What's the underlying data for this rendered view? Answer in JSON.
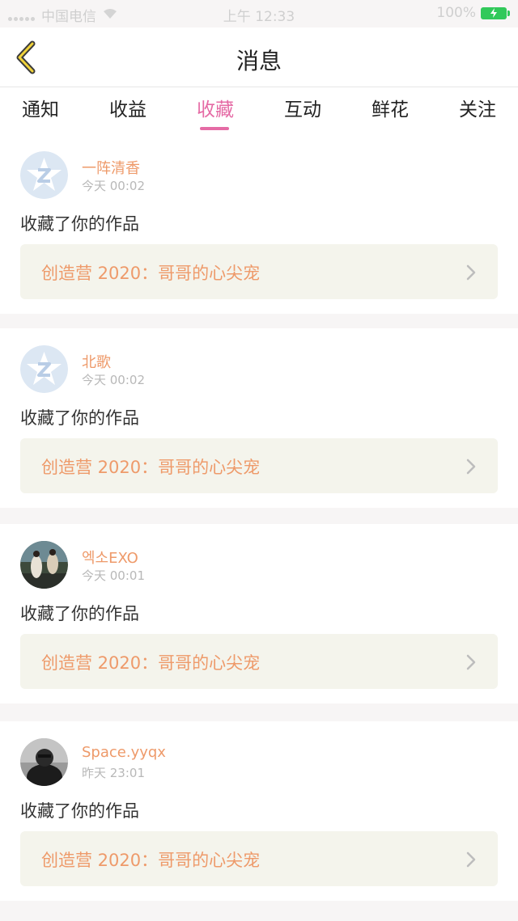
{
  "status_bar": {
    "carrier": "中国电信",
    "time": "上午 12:33",
    "battery": "100%"
  },
  "nav": {
    "title": "消息",
    "back_icon": "chevron-left-icon"
  },
  "tabs": [
    {
      "label": "通知",
      "active": false
    },
    {
      "label": "收益",
      "active": false
    },
    {
      "label": "收藏",
      "active": true
    },
    {
      "label": "互动",
      "active": false
    },
    {
      "label": "鲜花",
      "active": false
    },
    {
      "label": "关注",
      "active": false
    }
  ],
  "colors": {
    "accent": "#e56ba5",
    "username": "#ee9a6a",
    "card_bg": "#f4f4ec",
    "page_bg": "#f7f5f5"
  },
  "items": [
    {
      "username": "一阵清香",
      "time": "今天 00:02",
      "action": "收藏了你的作品",
      "work": "创造营 2020：哥哥的心尖宠",
      "avatar": "default-qq-avatar"
    },
    {
      "username": "北歌",
      "time": "今天 00:02",
      "action": "收藏了你的作品",
      "work": "创造营 2020：哥哥的心尖宠",
      "avatar": "default-qq-avatar"
    },
    {
      "username": "엑소EXO",
      "time": "今天 00:01",
      "action": "收藏了你的作品",
      "work": "创造营 2020：哥哥的心尖宠",
      "avatar": "photo-avatar"
    },
    {
      "username": "Space.yyqx",
      "time": "昨天 23:01",
      "action": "收藏了你的作品",
      "work": "创造营 2020：哥哥的心尖宠",
      "avatar": "photo-avatar"
    }
  ]
}
